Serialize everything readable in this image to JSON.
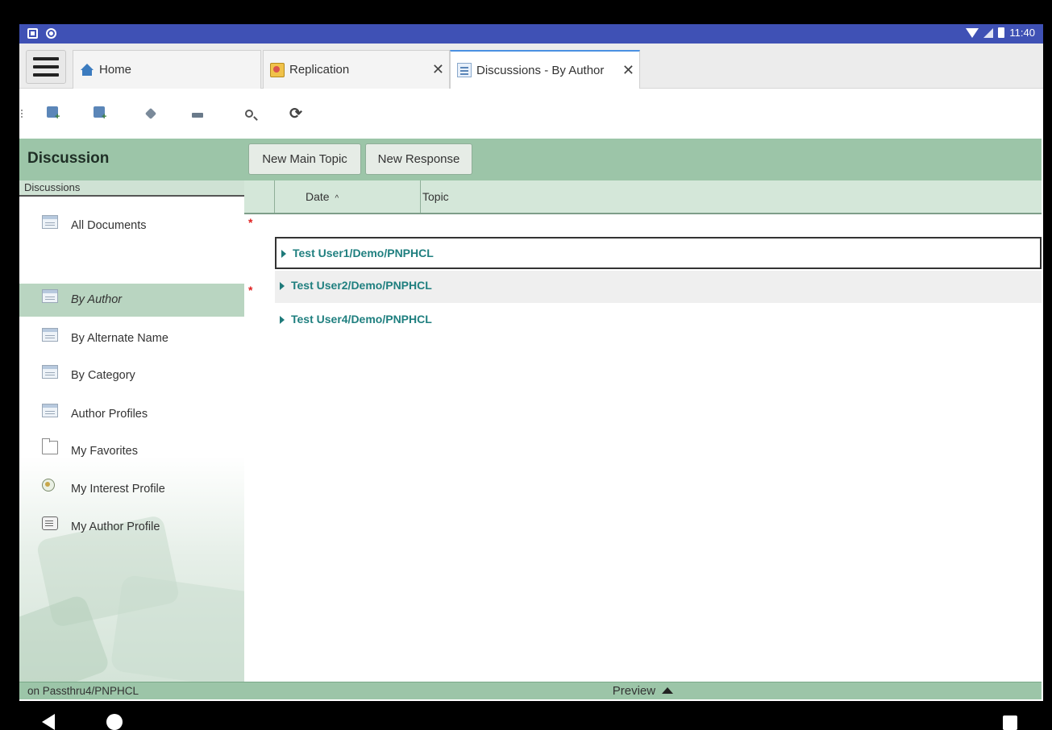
{
  "status": {
    "time": "11:40"
  },
  "tabs": [
    {
      "label": "Home",
      "icon": "home-icon"
    },
    {
      "label": "Replication",
      "icon": "replication-icon",
      "close": "✕"
    },
    {
      "label": "Discussions - By Author",
      "icon": "discussion-db-icon",
      "close": "✕",
      "active": true
    }
  ],
  "toolbar": {
    "tools": [
      {
        "name": "new-main-topic-tool",
        "icon": "new-document-icon"
      },
      {
        "name": "new-response-tool",
        "icon": "new-response-icon"
      },
      {
        "name": "edit-document-tool",
        "icon": "edit-icon"
      },
      {
        "name": "delete-document-tool",
        "icon": "delete-icon"
      },
      {
        "name": "search-tool",
        "icon": "search-icon"
      },
      {
        "name": "refresh-tool",
        "icon": "refresh-icon",
        "glyph": "⟳"
      }
    ]
  },
  "header": {
    "title": "Discussion",
    "new_main_topic": "New Main Topic",
    "new_response": "New Response"
  },
  "nav": {
    "header": "Discussions",
    "items": [
      {
        "label": "All Documents",
        "icon": "view-icon"
      },
      {
        "label": "By Author",
        "icon": "view-icon",
        "selected": true
      },
      {
        "label": "By Alternate Name",
        "icon": "view-icon"
      },
      {
        "label": "By Category",
        "icon": "view-icon"
      },
      {
        "label": "Author Profiles",
        "icon": "view-icon"
      },
      {
        "label": "My Favorites",
        "icon": "folder-icon"
      },
      {
        "label": "My Interest Profile",
        "icon": "interest-profile-icon"
      },
      {
        "label": "My Author Profile",
        "icon": "author-profile-icon"
      }
    ],
    "footer": "on Passthru4/PNPHCL"
  },
  "view": {
    "columns": {
      "date": "Date",
      "sort_indicator": "^",
      "topic": "Topic"
    },
    "rows": [
      {
        "label": "Test User1/Demo/PNPHCL",
        "unread": true
      },
      {
        "label": "Test User2/Demo/PNPHCL",
        "unread": false
      },
      {
        "label": "Test User4/Demo/PNPHCL",
        "unread": true
      }
    ],
    "unread_marker": "*"
  },
  "preview": {
    "label": "Preview"
  },
  "colors": {
    "band": "#9cc5a8",
    "status_bar": "#3f51b5",
    "row_text": "#1f7f7f",
    "unread": "#e02020"
  }
}
